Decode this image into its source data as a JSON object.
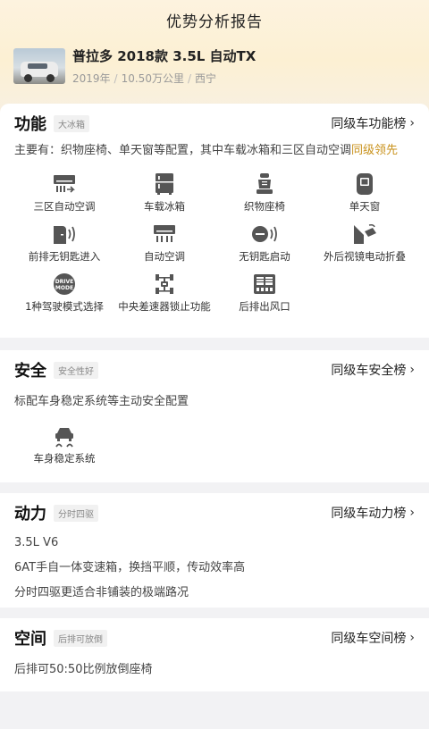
{
  "page": {
    "title": "优势分析报告"
  },
  "car": {
    "name": "普拉多 2018款 3.5L 自动TX",
    "year": "2019年",
    "mileage": "10.50万公里",
    "city": "西宁"
  },
  "sections": {
    "function": {
      "title": "功能",
      "tag": "大冰箱",
      "rank": "同级车功能榜",
      "desc_prefix": "主要有：织物座椅、单天窗等配置，其中车载冰箱和三区自动空调",
      "desc_highlight": "同级领先",
      "features": [
        {
          "label": "三区自动空调",
          "icon": "climate-zone-icon"
        },
        {
          "label": "车载冰箱",
          "icon": "fridge-icon"
        },
        {
          "label": "织物座椅",
          "icon": "seat-icon"
        },
        {
          "label": "单天窗",
          "icon": "sunroof-icon"
        },
        {
          "label": "前排无钥匙进入",
          "icon": "keyless-entry-icon"
        },
        {
          "label": "自动空调",
          "icon": "auto-ac-icon"
        },
        {
          "label": "无钥匙启动",
          "icon": "keyless-start-icon"
        },
        {
          "label": "外后视镜电动折叠",
          "icon": "mirror-fold-icon"
        },
        {
          "label": "1种驾驶模式选择",
          "icon": "drive-mode-icon",
          "icon_text": "DRIVE MODE"
        },
        {
          "label": "中央差速器锁止功能",
          "icon": "diff-lock-icon"
        },
        {
          "label": "后排出风口",
          "icon": "rear-vent-icon"
        }
      ]
    },
    "safety": {
      "title": "安全",
      "tag": "安全性好",
      "rank": "同级车安全榜",
      "desc": "标配车身稳定系统等主动安全配置",
      "features": [
        {
          "label": "车身稳定系统",
          "icon": "stability-control-icon"
        }
      ]
    },
    "power": {
      "title": "动力",
      "tag": "分时四驱",
      "rank": "同级车动力榜",
      "lines": [
        "3.5L V6",
        "6AT手自一体变速箱，换挡平顺，传动效率高",
        "分时四驱更适合非铺装的极端路况"
      ]
    },
    "space": {
      "title": "空间",
      "tag": "后排可放倒",
      "rank": "同级车空间榜",
      "desc": "后排可50:50比例放倒座椅"
    }
  },
  "colors": {
    "highlight": "#c9921c",
    "icon": "#555555"
  }
}
